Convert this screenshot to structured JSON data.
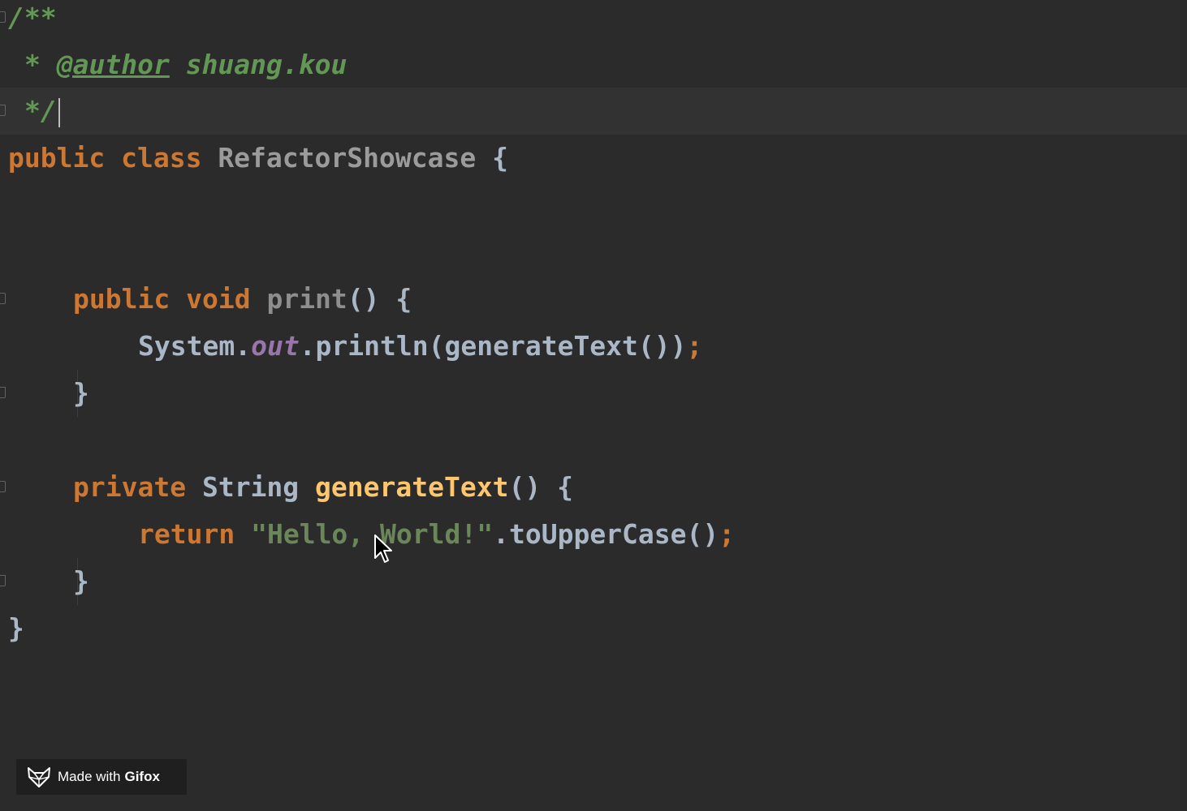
{
  "editor": {
    "lines": [
      {
        "tokens": [
          "/**"
        ]
      },
      {
        "tokens": [
          "* ",
          "@author",
          " shuang.kou"
        ]
      },
      {
        "tokens": [
          "*/"
        ]
      },
      {
        "tokens": [
          "public",
          " ",
          "class",
          " ",
          "RefactorShowcase",
          " {"
        ]
      },
      {
        "tokens": []
      },
      {
        "tokens": []
      },
      {
        "tokens": [
          "public",
          " ",
          "void",
          " ",
          "print",
          "() {"
        ]
      },
      {
        "tokens": [
          "System.",
          "out",
          ".println(generateText())",
          ";"
        ]
      },
      {
        "tokens": [
          "}"
        ]
      },
      {
        "tokens": []
      },
      {
        "tokens": [
          "private",
          " ",
          "String",
          " ",
          "generateText",
          "() {"
        ]
      },
      {
        "tokens": [
          "return",
          " ",
          "\"Hello, World!\"",
          ".toUpperCase()",
          ";"
        ]
      },
      {
        "tokens": [
          "}"
        ]
      },
      {
        "tokens": [
          "}"
        ]
      }
    ],
    "current_line": 3,
    "colors": {
      "background": "#2b2b2b",
      "current_line": "#323232",
      "keyword": "#cc7832",
      "string": "#6a8759",
      "doc_comment": "#629755",
      "method": "#ffc66d",
      "field": "#9876aa",
      "text": "#a9b7c6"
    }
  },
  "watermark": {
    "icon": "fox-icon",
    "prefix": "Made with",
    "brand": "Gifox"
  }
}
